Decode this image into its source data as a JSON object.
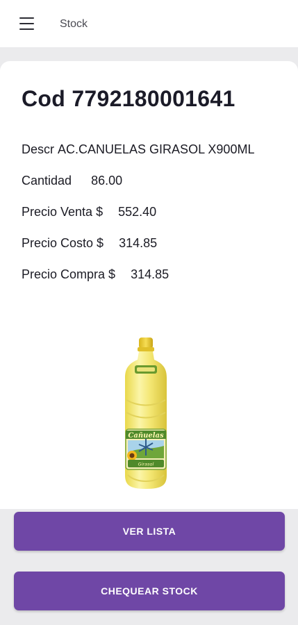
{
  "appbar": {
    "title": "Stock",
    "menu_icon": "hamburger-menu-icon"
  },
  "product": {
    "code_label": "Cod",
    "code": "7792180001641",
    "descr_label": "Descr",
    "descr": "AC.CANUELAS GIRASOL X900ML",
    "cantidad_label": "Cantidad",
    "cantidad": "86.00",
    "precio_venta_label": "Precio Venta $",
    "precio_venta": "552.40",
    "precio_costo_label": "Precio Costo $",
    "precio_costo": "314.85",
    "precio_compra_label": "Precio Compra $",
    "precio_compra": "314.85",
    "image_brand_text": "Cañuelas",
    "image_variant_text": "Girasol"
  },
  "actions": {
    "ver_lista": "VER LISTA",
    "chequear_stock": "CHEQUEAR STOCK"
  },
  "colors": {
    "accent": "#6f47a6",
    "background": "#ebebed",
    "card": "#ffffff"
  }
}
